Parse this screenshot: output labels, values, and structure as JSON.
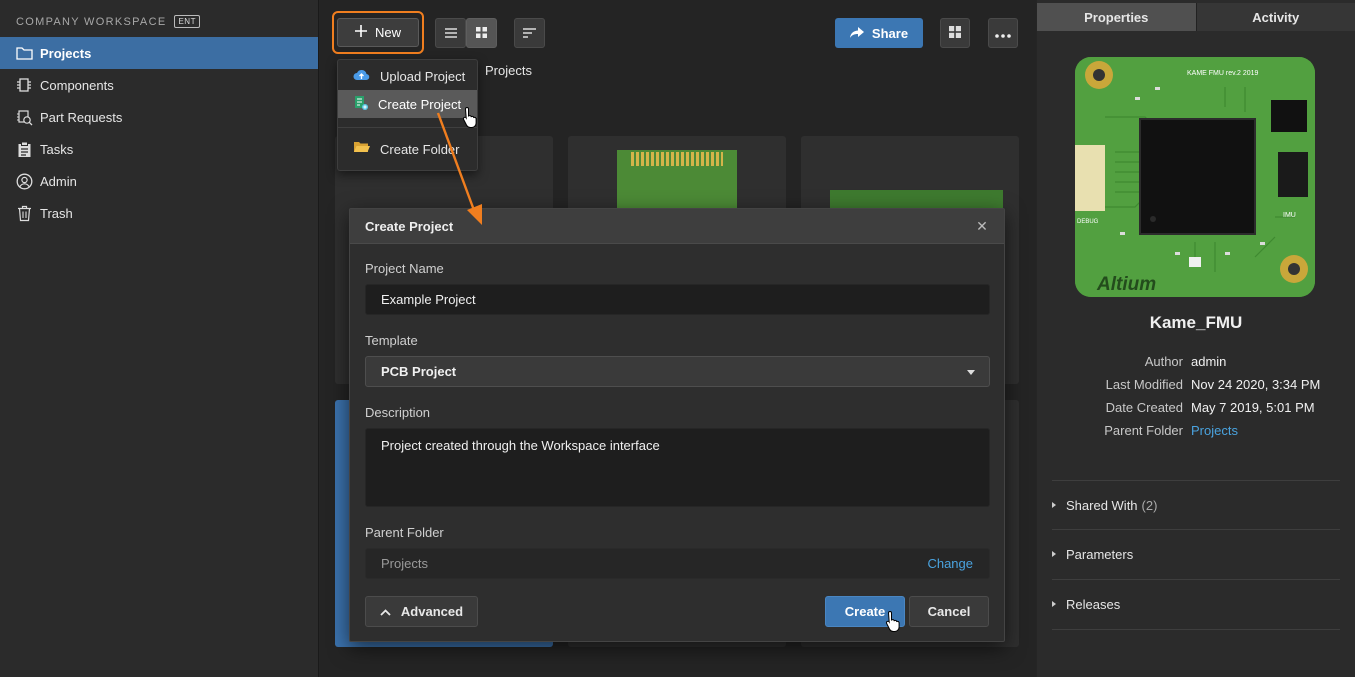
{
  "workspace": {
    "title": "COMPANY WORKSPACE",
    "badge": "ENT"
  },
  "sidebar": {
    "items": [
      {
        "label": "Projects",
        "icon": "folder-icon",
        "active": true
      },
      {
        "label": "Components",
        "icon": "component-icon"
      },
      {
        "label": "Part Requests",
        "icon": "part-request-icon"
      },
      {
        "label": "Tasks",
        "icon": "clipboard-icon"
      },
      {
        "label": "Admin",
        "icon": "user-circle-icon"
      },
      {
        "label": "Trash",
        "icon": "trash-icon"
      }
    ]
  },
  "toolbar": {
    "new_label": "New",
    "share_label": "Share"
  },
  "breadcrumb": "Projects",
  "new_menu": {
    "items": [
      {
        "label": "Upload Project",
        "icon": "cloud-upload-icon"
      },
      {
        "label": "Create Project",
        "icon": "create-project-icon",
        "highlighted": true
      },
      {
        "label": "Create Folder",
        "icon": "folder-open-icon"
      }
    ]
  },
  "dialog": {
    "title": "Create Project",
    "project_name_label": "Project Name",
    "project_name_value": "Example Project",
    "template_label": "Template",
    "template_value": "PCB Project",
    "description_label": "Description",
    "description_value": "Project created through the Workspace interface",
    "parent_folder_label": "Parent Folder",
    "parent_folder_value": "Projects",
    "change_label": "Change",
    "advanced_label": "Advanced",
    "create_label": "Create",
    "cancel_label": "Cancel"
  },
  "panel": {
    "tabs": [
      {
        "label": "Properties",
        "active": true
      },
      {
        "label": "Activity"
      }
    ],
    "board_text": {
      "title": "KAME FMU rev.2 2019",
      "imu": "IMU",
      "debug": "DEBUG",
      "brand": "Altium"
    },
    "project_name": "Kame_FMU",
    "properties": [
      {
        "key": "Author",
        "value": "admin"
      },
      {
        "key": "Last Modified",
        "value": "Nov 24 2020, 3:34 PM"
      },
      {
        "key": "Date Created",
        "value": "May 7 2019, 5:01 PM"
      },
      {
        "key": "Parent Folder",
        "value": "Projects",
        "link": true
      }
    ],
    "sections": [
      {
        "label": "Shared With",
        "count": "(2)"
      },
      {
        "label": "Parameters"
      },
      {
        "label": "Releases"
      }
    ]
  },
  "colors": {
    "accent": "#3c77b3",
    "highlight_orange": "#f07e1f",
    "link": "#4aa3df",
    "pcb_green": "#4e9a3e"
  }
}
